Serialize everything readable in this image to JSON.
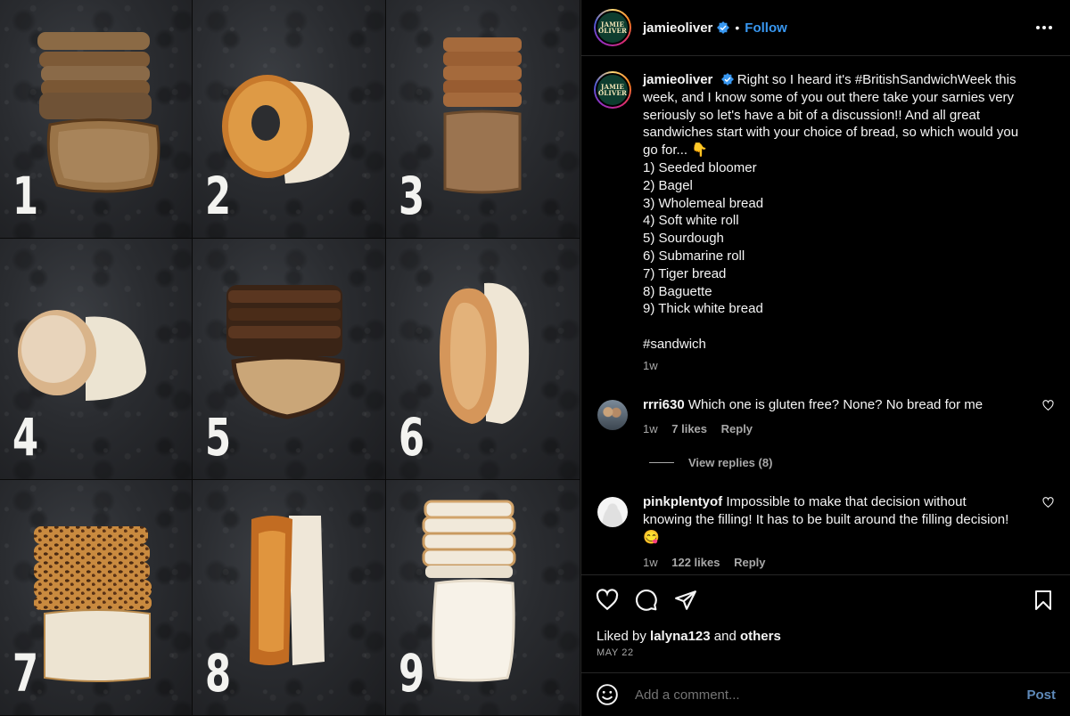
{
  "tiles": [
    "1",
    "2",
    "3",
    "4",
    "5",
    "6",
    "7",
    "8",
    "9"
  ],
  "header": {
    "username": "jamieoliver",
    "dot": "•",
    "follow_label": "Follow",
    "avatar_line1": "JAMIE",
    "avatar_line2": "OLIVER"
  },
  "caption": {
    "username": "jamieoliver",
    "intro": "Right so I heard it's #BritishSandwichWeek this week, and I know some of you out there take your sarnies very seriously so let's have a bit of a discussion!! And all great sandwiches start with your choice of bread, so which would you go for... 👇",
    "options": [
      "1) Seeded bloomer",
      "2) Bagel",
      "3) Wholemeal bread",
      "4) Soft white roll",
      "5) Sourdough",
      "6) Submarine roll",
      "7) Tiger bread",
      "8) Baguette",
      "9) Thick white bread"
    ],
    "hashtag": "#sandwich",
    "age": "1w"
  },
  "comments": [
    {
      "username": "rrri630",
      "text": "Which one is gluten free? None? No bread for me",
      "age": "1w",
      "likes": "7 likes",
      "reply": "Reply",
      "view_replies": "View replies (8)"
    },
    {
      "username": "pinkplentyof",
      "text": "Impossible to make that decision without knowing the filling! It has to be built around the filling decision!😋",
      "age": "1w",
      "likes": "122 likes",
      "reply": "Reply"
    }
  ],
  "liked_by": {
    "prefix": "Liked by",
    "user": "lalyna123",
    "conj": "and",
    "others": "others"
  },
  "date": "MAY 22",
  "add_comment": {
    "placeholder": "Add a comment...",
    "post_label": "Post"
  },
  "colors": {
    "link_blue": "#3897f0",
    "post_blue": "#5e89b8",
    "muted": "#a8a8a8",
    "divider": "#262626"
  },
  "icons": [
    "verified-badge-icon",
    "more-options-icon",
    "heart-icon",
    "comment-icon",
    "share-icon",
    "bookmark-icon",
    "emoji-icon"
  ]
}
